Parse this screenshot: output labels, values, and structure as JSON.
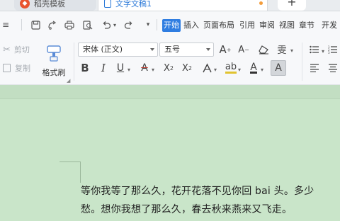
{
  "tabs": [
    {
      "label": "稻壳模板"
    },
    {
      "label": "文字文稿1"
    }
  ],
  "newtab_label": "+",
  "menu": [
    "开始",
    "插入",
    "页面布局",
    "引用",
    "审阅",
    "视图",
    "章节",
    "开发"
  ],
  "active_menu": "开始",
  "ribbon": {
    "cut_label": "剪切",
    "copy_label": "复制",
    "format_painter_label": "格式刷",
    "font_name": "宋体 (正文)",
    "font_size": "五号"
  },
  "document": {
    "line1": "等你我等了那么久，花开花落不见你回 bai 头。多少",
    "line2": "愁。想你我想了那么久，春去秋来燕来又飞走。"
  },
  "colors": {
    "accent": "#2f7de1",
    "page_bg": "#c9e5c9"
  }
}
